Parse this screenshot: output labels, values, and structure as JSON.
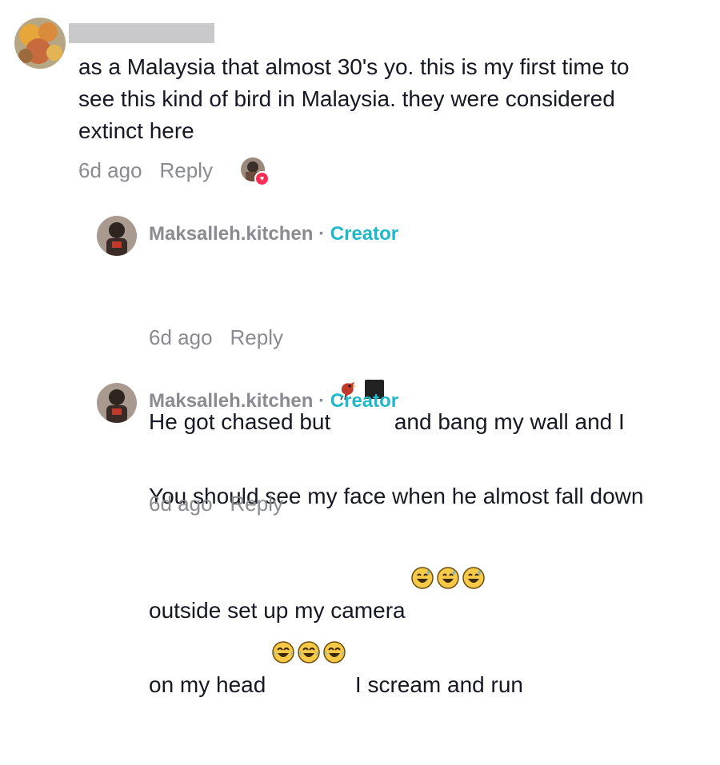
{
  "comments": [
    {
      "username": "",
      "text": "as a Malaysia that almost 30's yo. this is my first time to\nsee this kind of bird in Malaysia. they were considered\nextinct here",
      "time": "6d ago",
      "reply_label": "Reply",
      "liked_by_creator": true
    },
    {
      "username": "Maksalleh.kitchen",
      "separator": "·",
      "badge": "Creator",
      "text_part1": "He got chased but",
      "text_part2": "and bang my wall and I",
      "text_line2": "outside set up my camera",
      "emojis": [
        "bird-emoji",
        "black-square-emoji",
        "grinning-sweat-emoji",
        "grinning-sweat-emoji",
        "grinning-sweat-emoji"
      ],
      "time": "6d ago",
      "reply_label": "Reply"
    },
    {
      "username": "Maksalleh.kitchen",
      "separator": "·",
      "badge": "Creator",
      "text_line1": "You should see my face when he almost fall down",
      "text_line2_a": "on my head",
      "text_line2_b": "I scream and run",
      "emojis": [
        "joy-emoji",
        "joy-emoji",
        "joy-emoji"
      ],
      "time": "6d ago",
      "reply_label": "Reply"
    }
  ],
  "colors": {
    "text": "#161823",
    "muted": "#8a8b91",
    "creator_badge": "#20b8c9",
    "like_heart": "#fe2c55"
  }
}
